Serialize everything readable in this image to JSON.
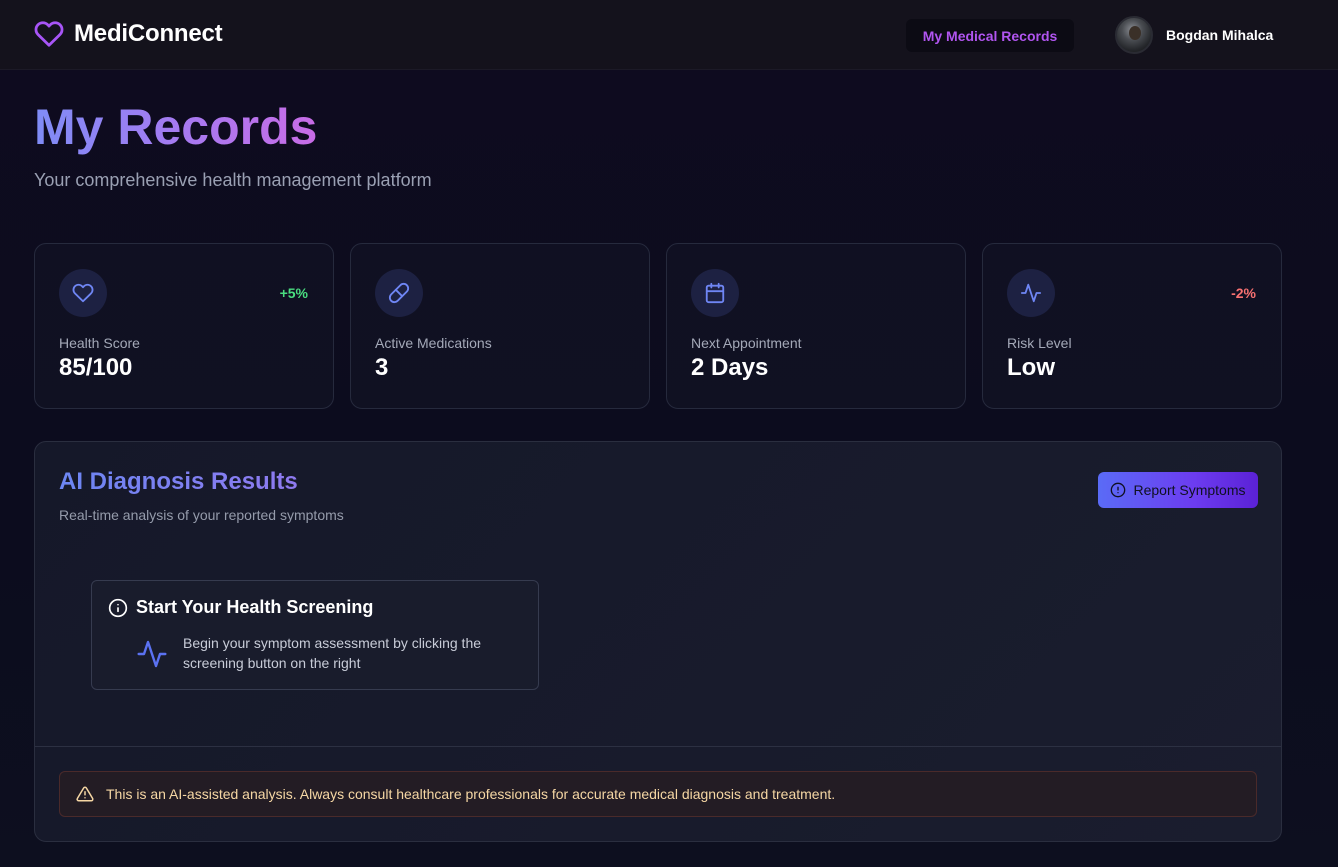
{
  "app": {
    "brand_name": "MediConnect",
    "brand_icon": "heart-icon",
    "accent_color": "#a855f7"
  },
  "nav": {
    "records_link": "My Medical Records"
  },
  "user": {
    "name": "Bogdan Mihalca"
  },
  "page": {
    "title": "My Records",
    "subtitle": "Your comprehensive health management platform"
  },
  "stats": [
    {
      "icon": "heart-icon",
      "label": "Health Score",
      "value": "85/100",
      "change": "+5%",
      "change_color": "#4ade80"
    },
    {
      "icon": "pill-icon",
      "label": "Active Medications",
      "value": "3",
      "change": ""
    },
    {
      "icon": "calendar-icon",
      "label": "Next Appointment",
      "value": "2 Days",
      "change": ""
    },
    {
      "icon": "activity-icon",
      "label": "Risk Level",
      "value": "Low",
      "change": "-2%",
      "change_color": "#f87171"
    }
  ],
  "diagnosis": {
    "title": "AI Diagnosis Results",
    "subtitle": "Real-time analysis of your reported symptoms",
    "report_button": "Report Symptoms",
    "screening": {
      "title": "Start Your Health Screening",
      "text": "Begin your symptom assessment by clicking the screening button on the right"
    },
    "disclaimer": "This is an AI-assisted analysis. Always consult healthcare professionals for accurate medical diagnosis and treatment."
  }
}
